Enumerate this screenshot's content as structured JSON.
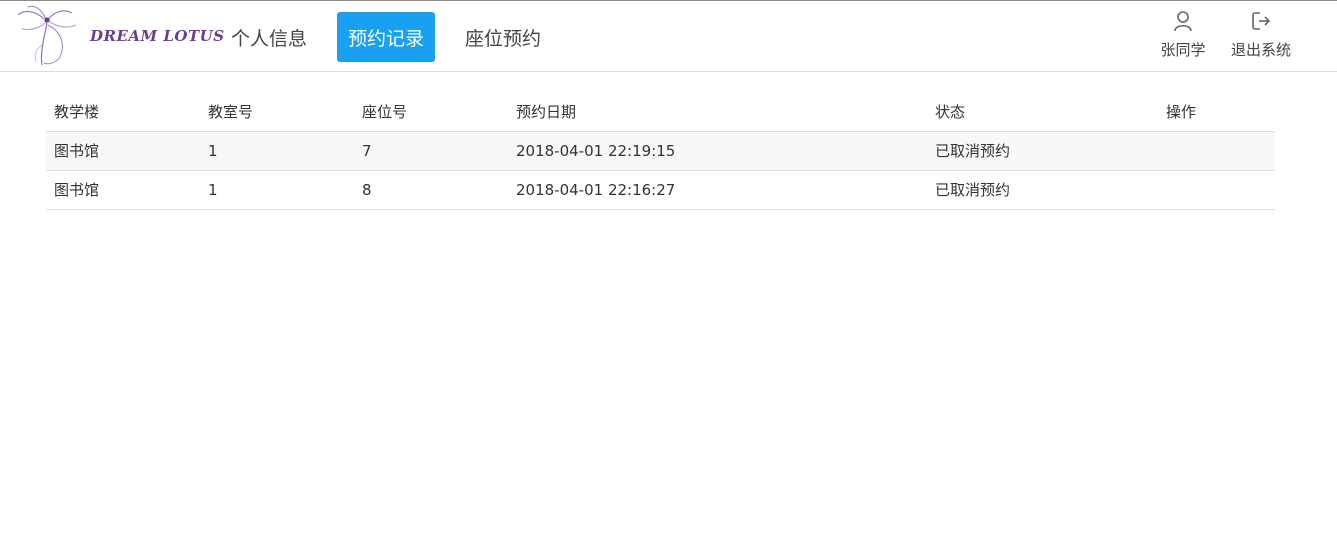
{
  "brand": {
    "logo_text": "DREAM LOTUS",
    "accent": "#1aa0f0",
    "logo_color": "#6a3f8f"
  },
  "nav": {
    "items": [
      {
        "label": "个人信息",
        "active": false
      },
      {
        "label": "预约记录",
        "active": true
      },
      {
        "label": "座位预约",
        "active": false
      }
    ]
  },
  "user": {
    "name": "张同学",
    "name_icon": "user-icon",
    "logout_label": "退出系统",
    "logout_icon": "logout-icon"
  },
  "table": {
    "headers": [
      "教学楼",
      "教室号",
      "座位号",
      "预约日期",
      "状态",
      "操作"
    ],
    "rows": [
      [
        "图书馆",
        "1",
        "7",
        "2018-04-01 22:19:15",
        "已取消预约",
        ""
      ],
      [
        "图书馆",
        "1",
        "8",
        "2018-04-01 22:16:27",
        "已取消预约",
        ""
      ]
    ]
  }
}
